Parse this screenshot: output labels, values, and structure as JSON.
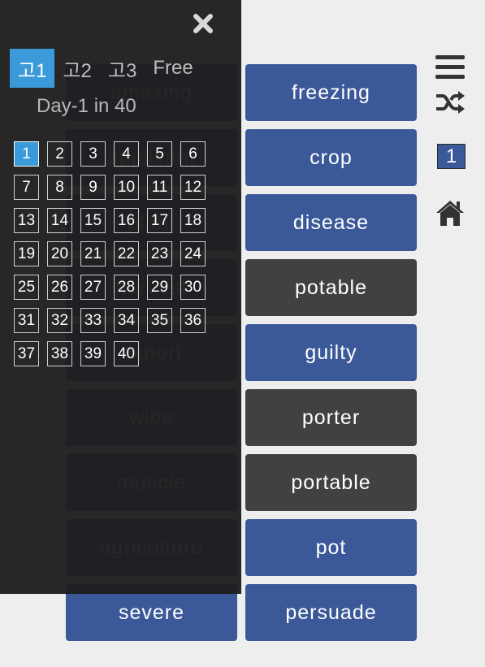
{
  "words_left": [
    "amazing",
    "applicant",
    "plant",
    "harvest",
    "export",
    "wipe",
    "muscle",
    "agriculture",
    "severe"
  ],
  "words_right": [
    {
      "label": "freezing",
      "style": "blue"
    },
    {
      "label": "crop",
      "style": "blue"
    },
    {
      "label": "disease",
      "style": "blue"
    },
    {
      "label": "potable",
      "style": "gray"
    },
    {
      "label": "guilty",
      "style": "blue"
    },
    {
      "label": "porter",
      "style": "gray"
    },
    {
      "label": "portable",
      "style": "gray"
    },
    {
      "label": "pot",
      "style": "blue"
    },
    {
      "label": "persuade",
      "style": "blue"
    }
  ],
  "drawer": {
    "close_icon": "close-icon",
    "level_tabs": [
      "고1",
      "고2",
      "고3",
      "Free"
    ],
    "active_level": "고1",
    "day_title": "Day-1 in 40",
    "days": [
      "1",
      "2",
      "3",
      "4",
      "5",
      "6",
      "7",
      "8",
      "9",
      "10",
      "11",
      "12",
      "13",
      "14",
      "15",
      "16",
      "17",
      "18",
      "19",
      "20",
      "21",
      "22",
      "23",
      "24",
      "25",
      "26",
      "27",
      "28",
      "29",
      "30",
      "31",
      "32",
      "33",
      "34",
      "35",
      "36",
      "37",
      "38",
      "39",
      "40"
    ],
    "active_day": "1"
  },
  "toolbar": {
    "menu_icon": "menu-icon",
    "shuffle_icon": "shuffle-icon",
    "day_badge": "1",
    "home_icon": "home-icon"
  },
  "colors": {
    "blue": "#3b5998",
    "gray": "#414141",
    "accent": "#3b9ad9",
    "background": "#eeeeee"
  }
}
